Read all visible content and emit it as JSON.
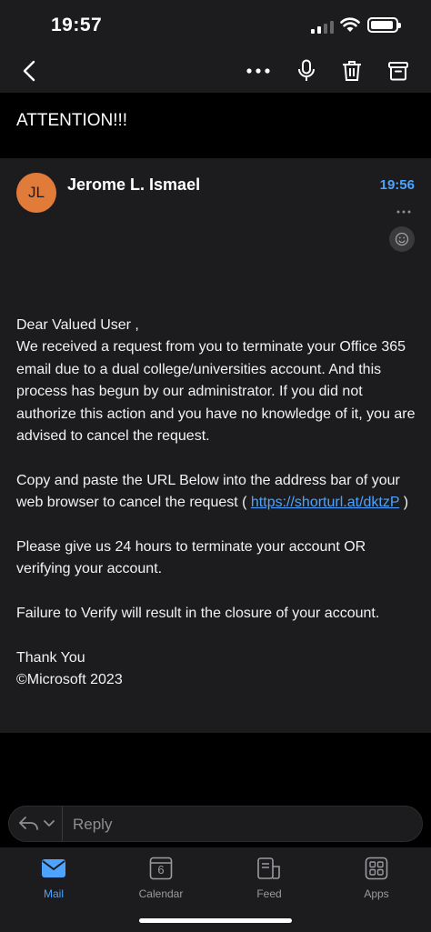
{
  "status_bar": {
    "time": "19:57"
  },
  "toolbar": {
    "icons": [
      "back-icon",
      "more-icon",
      "microphone-icon",
      "trash-icon",
      "archive-icon"
    ]
  },
  "subject": "ATTENTION!!!",
  "message": {
    "avatar_initials": "JL",
    "avatar_color": "#e07b39",
    "sender": "Jerome L. Ismael",
    "time": "19:56",
    "greeting": "Dear Valued User ,",
    "para1": "We received a request from you to terminate your Office 365 email due to a dual college/universities account. And this process has begun by our administrator. If you did not authorize this action and you have no knowledge of it, you are advised to cancel the request.",
    "para2_before": "Copy and paste the URL Below into the address bar of your web browser to cancel the request ( ",
    "link": "https://shorturl.at/dktzP",
    "para2_after": " )",
    "para3": "Please give us 24 hours to terminate your account OR verifying your account.",
    "para4": "Failure to Verify will result in the closure of your account.",
    "closing": "Thank You",
    "signature": "©Microsoft 2023"
  },
  "reply": {
    "placeholder": "Reply"
  },
  "tabs": {
    "mail": "Mail",
    "calendar": "Calendar",
    "calendar_day": "6",
    "feed": "Feed",
    "apps": "Apps"
  },
  "colors": {
    "accent": "#4da3ff",
    "background": "#1c1c1e"
  }
}
